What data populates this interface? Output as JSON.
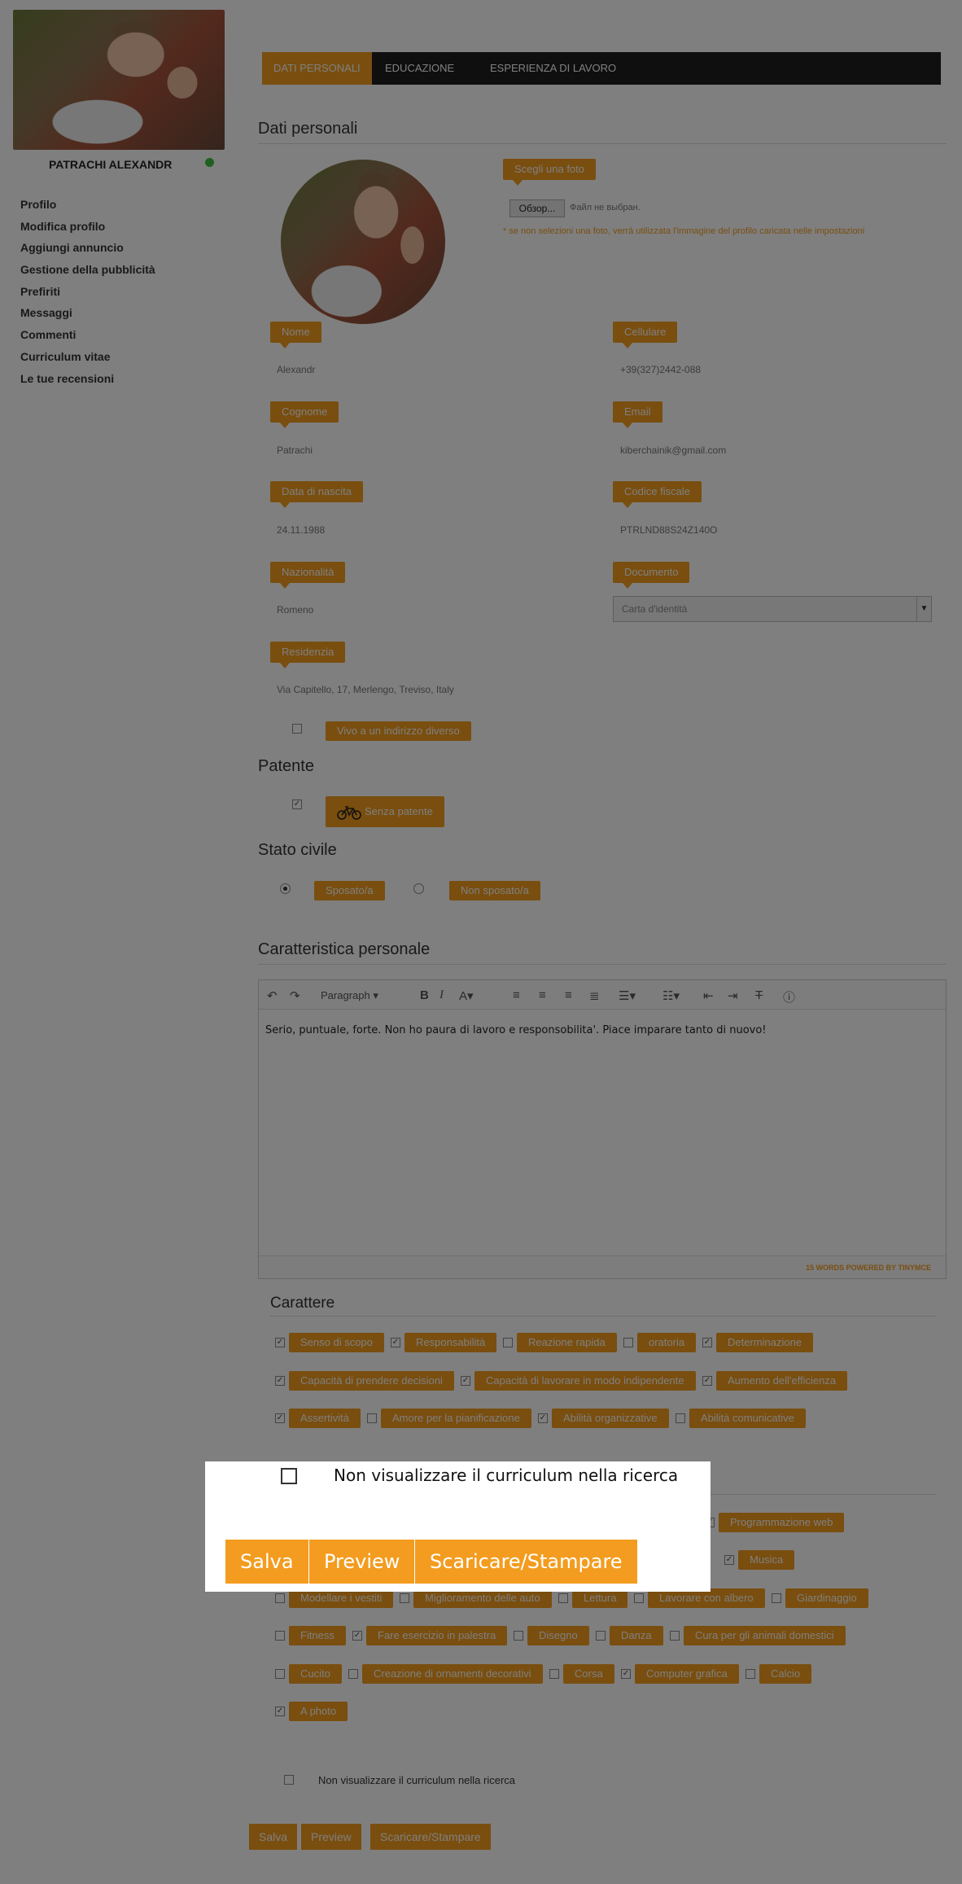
{
  "user": {
    "name": "PATRACHI ALEXANDR"
  },
  "menu": [
    "Profilo",
    "Modifica profilo",
    "Aggiungi annuncio",
    "Gestione della pubblicità",
    "Prefiriti",
    "Messaggi",
    "Commenti",
    "Curriculum vitae",
    "Le tue recensioni"
  ],
  "tabs": [
    "DATI PERSONALI",
    "EDUCAZIONE",
    "ESPERIENZA DI LAVORO"
  ],
  "section_title": "Dati personali",
  "photo": {
    "choose_label": "Scegli una foto",
    "browse_button": "Обзор...",
    "no_file_text": "Файл не выбран.",
    "note": "* se non selezioni una foto, verrà utilizzata l'immagine del profilo caricata nelle impostazioni"
  },
  "fields": {
    "nome": {
      "label": "Nome",
      "value": "Alexandr"
    },
    "cellulare": {
      "label": "Cellulare",
      "value": "+39(327)2442-088"
    },
    "cognome": {
      "label": "Cognome",
      "value": "Patrachi"
    },
    "email": {
      "label": "Email",
      "value": "kiberchainik@gmail.com"
    },
    "data_nascita": {
      "label": "Data di nascita",
      "value": "24.11.1988"
    },
    "codice_fiscale": {
      "label": "Codice fiscale",
      "value": "PTRLND88S24Z140O"
    },
    "nazionalita": {
      "label": "Nazionalità",
      "value": "Romeno"
    },
    "documento": {
      "label": "Documento",
      "value": "Carta d'identità"
    },
    "residenza": {
      "label": "Residenzia",
      "value": "Via Capitello, 17, Merlengo, Treviso, Italy"
    }
  },
  "altro_indirizzo": "Vivo a un indirizzo diverso",
  "patente": {
    "title": "Patente",
    "option": "Senza patente",
    "icon": "bicycle-icon"
  },
  "stato_civile": {
    "title": "Stato civile",
    "options": [
      "Sposato/a",
      "Non sposato/a"
    ],
    "selected": "Sposato/a"
  },
  "caratteristica": {
    "title": "Caratteristica personale",
    "format_select": "Paragraph",
    "text": "Serio, puntuale, forte. Non ho paura di lavoro e responsobilita'. Piace imparare tanto di nuovo!",
    "status": "15 WORDS POWERED BY TINYMCE"
  },
  "carattere": {
    "title": "Carattere",
    "rows": [
      [
        {
          "label": "Senso di scopo",
          "checked": true
        },
        {
          "label": "Responsabilità",
          "checked": true
        },
        {
          "label": "Reazione rapida",
          "checked": false
        },
        {
          "label": "oratoria",
          "checked": false
        },
        {
          "label": "Determinazione",
          "checked": true
        }
      ],
      [
        {
          "label": "Capacità di prendere decisioni",
          "checked": true
        },
        {
          "label": "Capacità di lavorare in modo indipendente",
          "checked": true
        },
        {
          "label": "Aumento dell'efficienza",
          "checked": true
        }
      ],
      [
        {
          "label": "Assertività",
          "checked": true
        },
        {
          "label": "Amore per la pianificazione",
          "checked": false
        },
        {
          "label": "Abilità organizzative",
          "checked": true
        },
        {
          "label": "Abilità comunicative",
          "checked": false
        }
      ]
    ]
  },
  "hobby": {
    "rows": [
      [
        {
          "label": "Programmazione web",
          "checked": true
        }
      ],
      [
        {
          "label": "Musica",
          "checked": true
        }
      ],
      [
        {
          "label": "Modellare i vestiti",
          "checked": false
        },
        {
          "label": "Miglioramento delle auto",
          "checked": false
        },
        {
          "label": "Lettura",
          "checked": false
        },
        {
          "label": "Lavorare con albero",
          "checked": false
        },
        {
          "label": "Giardinaggio",
          "checked": false
        }
      ],
      [
        {
          "label": "Fitness",
          "checked": false
        },
        {
          "label": "Fare esercizio in palestra",
          "checked": true
        },
        {
          "label": "Disegno",
          "checked": false
        },
        {
          "label": "Danza",
          "checked": false
        },
        {
          "label": "Cura per gli animali domestici",
          "checked": false
        }
      ],
      [
        {
          "label": "Cucito",
          "checked": false
        },
        {
          "label": "Creazione di ornamenti decorativi",
          "checked": false
        },
        {
          "label": "Corsa",
          "checked": false
        },
        {
          "label": "Computer grafica",
          "checked": true
        },
        {
          "label": "Calcio",
          "checked": false
        }
      ],
      [
        {
          "label": "A photo",
          "checked": true
        }
      ]
    ]
  },
  "hide_cv": "Non visualizzare il curriculum nella ricerca",
  "buttons": {
    "save": "Salva",
    "preview": "Preview",
    "download": "Scaricare/Stampare"
  },
  "modal": {
    "hide_cv": "Non visualizzare il curriculum nella ricerca",
    "save": "Salva",
    "preview": "Preview",
    "download": "Scaricare/Stampare"
  }
}
